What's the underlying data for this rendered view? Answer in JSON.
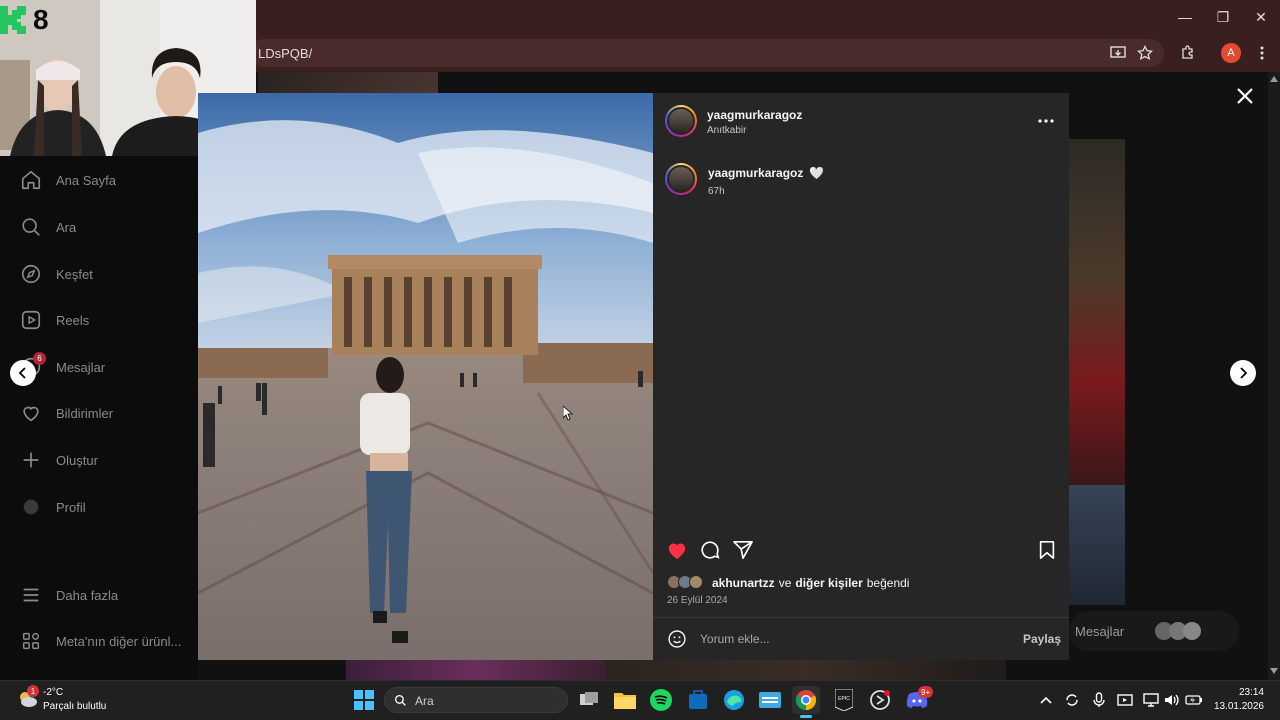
{
  "browser": {
    "url_fragment": "LDsPQB/",
    "profile_initial": "A"
  },
  "stream_overlay": {
    "channel_badge": "8"
  },
  "sidebar": {
    "items": [
      {
        "label": "Ana Sayfa",
        "icon": "home-icon"
      },
      {
        "label": "Ara",
        "icon": "search-icon"
      },
      {
        "label": "Keşfet",
        "icon": "compass-icon"
      },
      {
        "label": "Reels",
        "icon": "reels-icon"
      },
      {
        "label": "Mesajlar",
        "icon": "messenger-icon",
        "badge": "6"
      },
      {
        "label": "Bildirimler",
        "icon": "heart-icon"
      },
      {
        "label": "Oluştur",
        "icon": "plus-icon"
      },
      {
        "label": "Profil",
        "icon": "avatar-icon"
      }
    ],
    "more_label": "Daha fazla",
    "meta_label": "Meta'nın diğer ürünl..."
  },
  "post": {
    "username": "yaagmurkaragoz",
    "location": "Anıtkabir",
    "caption_username": "yaagmurkaragoz",
    "caption_emoji": "🤍",
    "caption_age": "67h",
    "liked_by_user": "akhunartzz",
    "liked_conjunction": "ve",
    "liked_others": "diğer kişiler",
    "liked_suffix": "beğendi",
    "date": "26 Eylül 2024",
    "comment_placeholder": "Yorum ekle...",
    "share_label": "Paylaş",
    "liked": true
  },
  "messages_pill": {
    "label": "Mesajlar"
  },
  "taskbar": {
    "weather_temp": "-2°C",
    "weather_desc": "Parçalı bulutlu",
    "weather_badge": "1",
    "search_label": "Ara",
    "time": "23:14",
    "date": "13.01.2026",
    "discord_badge": "9+"
  },
  "colors": {
    "like_red": "#ff3040",
    "panel_bg": "#262626",
    "chrome_bg": "#3a1f20",
    "taskbar_bg": "#202020"
  }
}
